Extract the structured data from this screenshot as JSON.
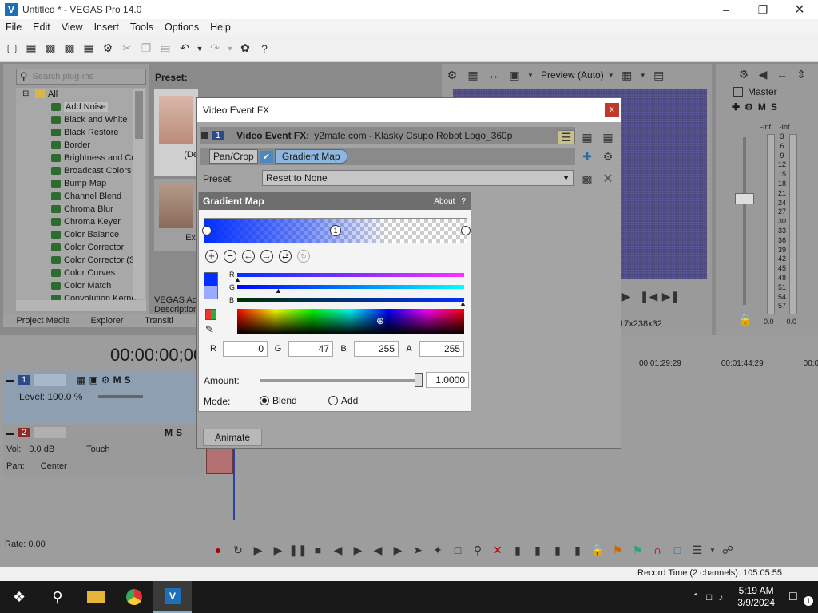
{
  "window": {
    "title": "Untitled * - VEGAS Pro 14.0"
  },
  "menu": [
    "File",
    "Edit",
    "View",
    "Insert",
    "Tools",
    "Options",
    "Help"
  ],
  "plugins": {
    "search_placeholder": "Search plug-ins",
    "root": "All",
    "items": [
      "Add Noise",
      "Black and White",
      "Black Restore",
      "Border",
      "Brightness and Co",
      "Broadcast Colors",
      "Bump Map",
      "Channel Blend",
      "Chroma Blur",
      "Chroma Keyer",
      "Color Balance",
      "Color Corrector",
      "Color Corrector (S",
      "Color Curves",
      "Color Match",
      "Convolution Kerne"
    ],
    "selected": "Add Noise",
    "preset_label": "Preset:",
    "thumb1_label": "(De",
    "thumb2_label": "Ext",
    "desc1": "VEGAS Add",
    "desc2": "Description",
    "tabs": [
      "Project Media",
      "Explorer",
      "Transiti"
    ]
  },
  "dialog": {
    "title": "Video Event FX",
    "close": "x",
    "track_num": "1",
    "fx_label": "Video Event FX:",
    "fx_source": "y2mate.com - Klasky Csupo Robot Logo_360p",
    "chain": [
      "Pan/Crop",
      "Gradient Map"
    ],
    "preset_label": "Preset:",
    "preset_value": "Reset to None",
    "animate": "Animate"
  },
  "gradient_map": {
    "title": "Gradient Map",
    "about": "About",
    "help": "?",
    "stop_label": "1",
    "channels": [
      "R",
      "G",
      "B"
    ],
    "rgba_labels": [
      "R",
      "G",
      "B",
      "A"
    ],
    "rgba_values": [
      "0",
      "47",
      "255",
      "255"
    ],
    "amount_label": "Amount:",
    "amount_value": "1.0000",
    "mode_label": "Mode:",
    "mode_options": [
      "Blend",
      "Add"
    ],
    "mode_selected": "Blend"
  },
  "preview": {
    "quality": "Preview (Auto)",
    "resolution": "17x238x32"
  },
  "master": {
    "title": "Master",
    "meter_top": [
      "-Inf.",
      "-Inf."
    ],
    "scale": [
      "3",
      "6",
      "9",
      "12",
      "15",
      "18",
      "21",
      "24",
      "27",
      "30",
      "33",
      "36",
      "39",
      "42",
      "45",
      "48",
      "51",
      "54",
      "57"
    ],
    "values": [
      "0.0",
      "0.0"
    ]
  },
  "timeline": {
    "timecode": "00:00:00;00",
    "ruler": [
      "00:01:29:29",
      "00:01:44:29",
      "00:0"
    ],
    "track1": {
      "num": "1",
      "level": "Level: 100.0 %"
    },
    "track2": {
      "num": "2",
      "vol_label": "Vol:",
      "vol_value": "0.0 dB",
      "pan_label": "Pan:",
      "pan_value": "Center",
      "touch": "Touch"
    },
    "meter_marks": [
      "-Inf.",
      "12",
      "24",
      "36",
      "48"
    ],
    "rate": "Rate: 0.00"
  },
  "status": {
    "record_time": "Record Time (2 channels): 105:05:55"
  },
  "taskbar": {
    "time": "5:19 AM",
    "date": "3/9/2024",
    "notif": "1"
  }
}
